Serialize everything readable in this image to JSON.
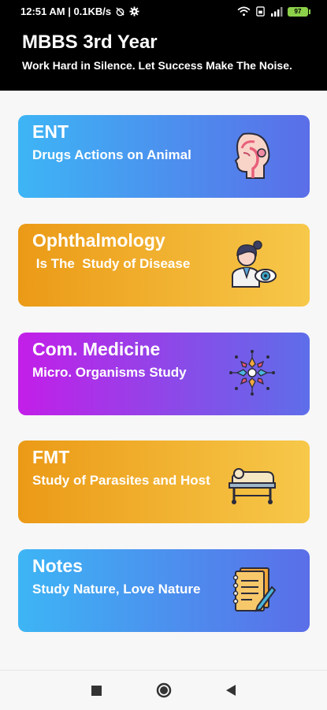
{
  "status_bar": {
    "time_speed": "12:51 AM | 0.1KB/s",
    "battery": "97"
  },
  "header": {
    "title": "MBBS 3rd Year",
    "subtitle": "Work Hard in Silence. Let Success Make The Noise."
  },
  "cards": [
    {
      "title": "ENT",
      "subtitle": "Drugs Actions on Animal",
      "icon": "ent-head-icon"
    },
    {
      "title": "Ophthalmology",
      "subtitle": " Is The  Study of Disease",
      "icon": "doctor-eye-icon"
    },
    {
      "title": "Com. Medicine",
      "subtitle": "Micro. Organisms Study",
      "icon": "microorganism-icon"
    },
    {
      "title": "FMT",
      "subtitle": "Study of Parasites and Host",
      "icon": "body-on-table-icon"
    },
    {
      "title": "Notes",
      "subtitle": "Study Nature, Love Nature",
      "icon": "notebook-pen-icon"
    }
  ],
  "colors": {
    "blue_gradient": [
      "#3db5f5",
      "#5a6ee8"
    ],
    "orange_gradient": [
      "#eb9a16",
      "#f7c84a"
    ],
    "purple_gradient": [
      "#c31ee8",
      "#5d6ee9"
    ]
  }
}
